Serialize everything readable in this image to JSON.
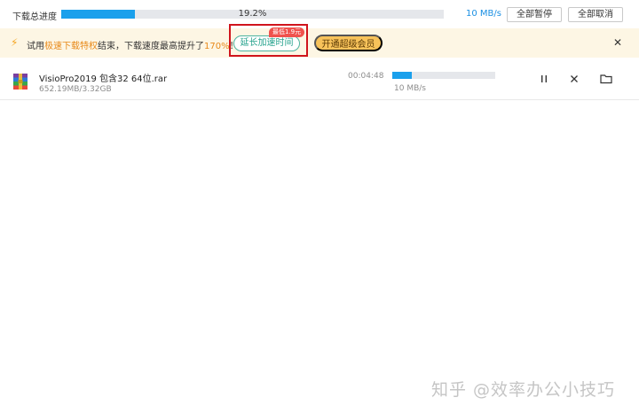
{
  "header": {
    "total_label": "下载总进度",
    "progress_text": "19.2%",
    "progress_fraction": 0.192,
    "speed": "10 MB/s",
    "pause_all_label": "全部暂停",
    "cancel_all_label": "全部取消"
  },
  "promo": {
    "text_prefix": "试用",
    "text_highlight": "极速下载特权",
    "text_middle": "结束，下载速度最高提升了",
    "text_percent": "170%",
    "text_suffix": "！",
    "extend_label": "延长加速时间",
    "badge_label": "最低1.9元",
    "vip_label": "开通超级会员",
    "close_icon": "close-icon"
  },
  "download": {
    "file_name": "VisioPro2019 包含32 64位.rar",
    "size_text": "652.19MB/3.32GB",
    "time_left": "00:04:48",
    "progress_fraction": 0.192,
    "speed": "10 MB/s",
    "icons": [
      "winrar-archive-icon",
      "pause-icon",
      "close-icon",
      "folder-icon"
    ]
  },
  "watermark": "知乎 @效率办公小技巧",
  "colors": {
    "accent": "#1aa0ec",
    "promo_bg": "#fdf6e4",
    "vip_bg": "#f7c25a",
    "highlight_box": "#d0141c",
    "badge": "#f0524d"
  }
}
